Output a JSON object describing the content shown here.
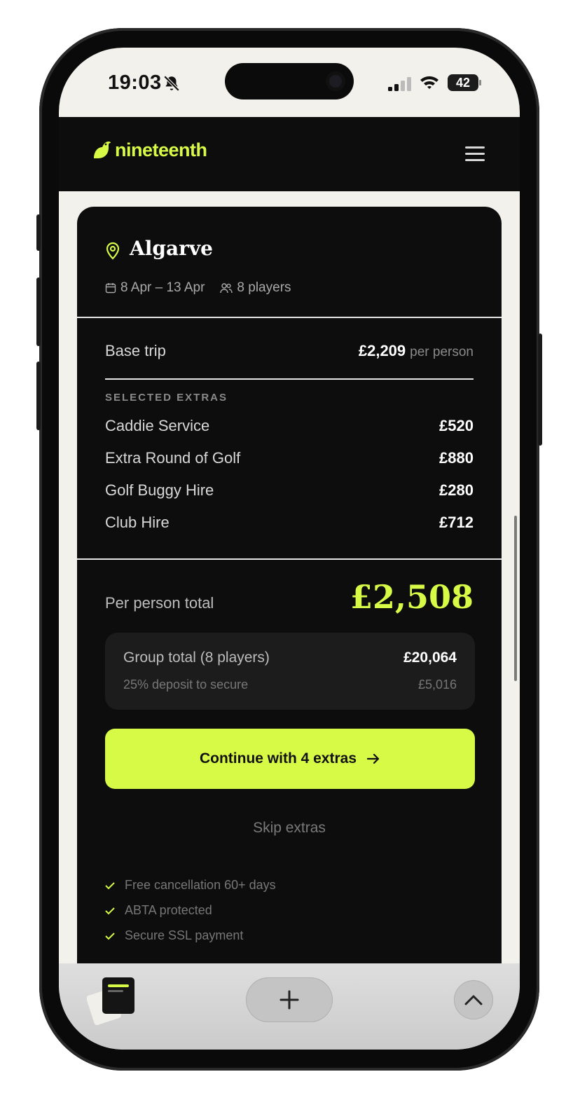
{
  "status_bar": {
    "time": "19:03",
    "battery": "42"
  },
  "header": {
    "brand": "nineteenth",
    "menu_icon": "hamburger-icon"
  },
  "trip": {
    "destination": "Algarve",
    "dates": "8 Apr – 13 Apr",
    "players": "8 players"
  },
  "pricing": {
    "base_label": "Base trip",
    "base_value": "£2,209",
    "base_suffix": "per person",
    "extras_heading": "SELECTED EXTRAS",
    "extras": [
      {
        "label": "Caddie Service",
        "value": "£520"
      },
      {
        "label": "Extra Round of Golf",
        "value": "£880"
      },
      {
        "label": "Golf Buggy Hire",
        "value": "£280"
      },
      {
        "label": "Club Hire",
        "value": "£712"
      }
    ],
    "total_label": "Per person total",
    "total_value": "£2,508",
    "group_label": "Group total (8 players)",
    "group_value": "£20,064",
    "deposit_label": "25% deposit to secure",
    "deposit_value": "£5,016"
  },
  "actions": {
    "continue_label": "Continue with 4 extras",
    "skip_label": "Skip extras"
  },
  "assurances": [
    "Free cancellation 60+ days",
    "ABTA protected",
    "Secure SSL payment"
  ],
  "colors": {
    "accent": "#d7fa46",
    "card_bg": "#0d0d0d",
    "page_bg": "#f3f1ec"
  }
}
